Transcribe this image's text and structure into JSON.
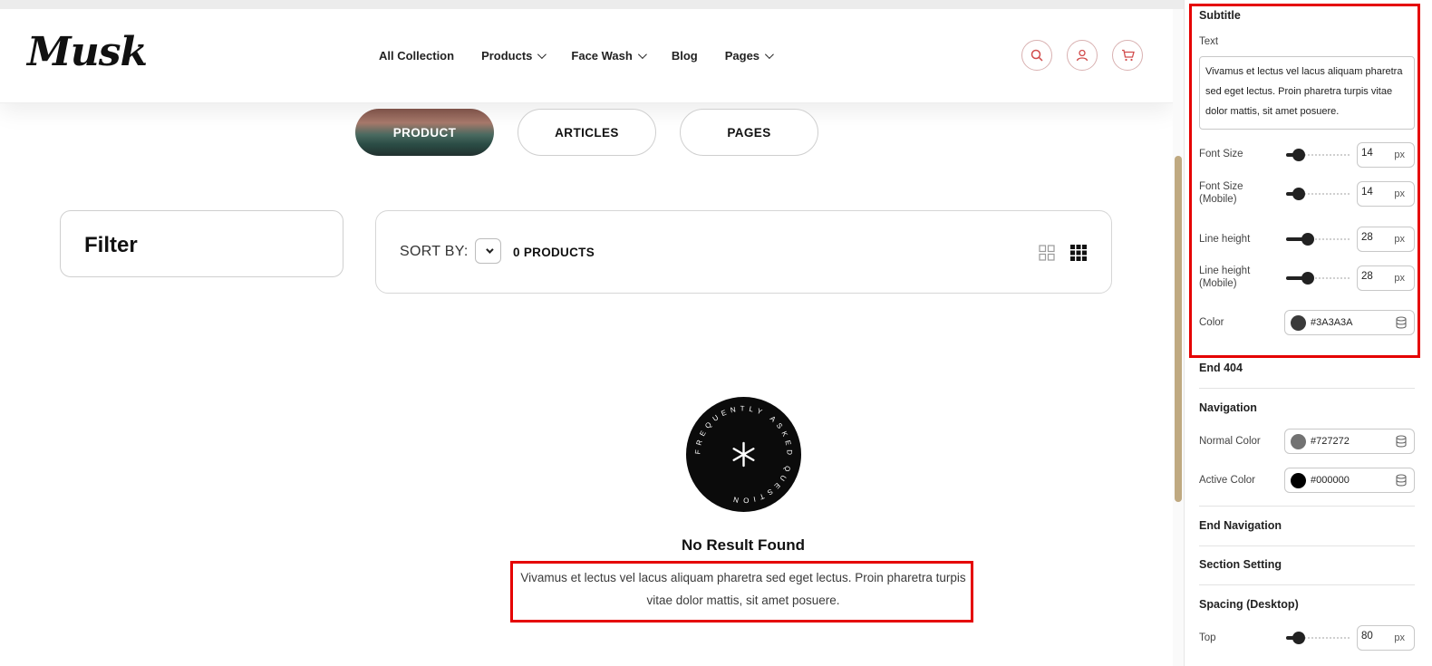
{
  "store": {
    "logo_text": "Musk",
    "nav": [
      {
        "label": "All Collection",
        "dropdown": false
      },
      {
        "label": "Products",
        "dropdown": true
      },
      {
        "label": "Face Wash",
        "dropdown": true
      },
      {
        "label": "Blog",
        "dropdown": false
      },
      {
        "label": "Pages",
        "dropdown": true
      }
    ],
    "header_icons": [
      "search-icon",
      "user-icon",
      "cart-icon"
    ]
  },
  "search_tabs": [
    {
      "label": "PRODUCT",
      "active": true
    },
    {
      "label": "ARTICLES",
      "active": false
    },
    {
      "label": "PAGES",
      "active": false
    }
  ],
  "filter": {
    "title": "Filter"
  },
  "sort": {
    "label": "SORT BY:",
    "count": "0 PRODUCTS",
    "view_icons": [
      "grid-2x2-icon",
      "grid-3x3-icon"
    ]
  },
  "empty": {
    "badge_text": "FREQUENTLY ASKED QUESTION",
    "badge_icon": "asterisk-icon",
    "title": "No Result Found",
    "subtitle": "Vivamus et lectus vel lacus aliquam pharetra sed eget lectus. Proin pharetra turpis vitae dolor mattis, sit amet posuere."
  },
  "panel": {
    "subtitle_heading": "Subtitle",
    "text_label": "Text",
    "text_value": "Vivamus et lectus vel lacus aliquam pharetra sed eget lectus. Proin pharetra turpis vitae dolor mattis, sit amet posuere.",
    "font_size": {
      "label": "Font Size",
      "value": "14",
      "unit": "px",
      "fraction": 0.2
    },
    "font_size_mobile": {
      "label": "Font Size (Mobile)",
      "value": "14",
      "unit": "px",
      "fraction": 0.2
    },
    "line_height": {
      "label": "Line height",
      "value": "28",
      "unit": "px",
      "fraction": 0.33
    },
    "line_height_mobile": {
      "label": "Line height (Mobile)",
      "value": "28",
      "unit": "px",
      "fraction": 0.33
    },
    "color": {
      "label": "Color",
      "value": "#3A3A3A"
    },
    "end_404": "End 404",
    "navigation_heading": "Navigation",
    "normal_color": {
      "label": "Normal Color",
      "value": "#727272"
    },
    "active_color": {
      "label": "Active Color",
      "value": "#000000"
    },
    "end_navigation": "End Navigation",
    "section_setting": "Section Setting",
    "spacing_heading": "Spacing (Desktop)",
    "top": {
      "label": "Top",
      "value": "80",
      "unit": "px",
      "fraction": 0.2
    }
  },
  "colors": {
    "highlight": "#e50000",
    "scroll_thumb": "#bfa981",
    "icon_accent": "#d14b4b"
  }
}
